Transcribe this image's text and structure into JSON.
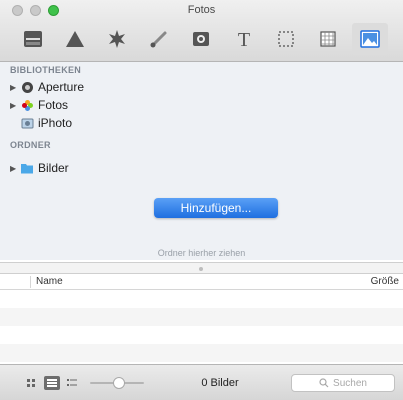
{
  "window": {
    "title": "Fotos"
  },
  "toolbar": {
    "tools": [
      {
        "icon": "media-browser-icon"
      },
      {
        "icon": "shapes-icon"
      },
      {
        "icon": "effects-icon"
      },
      {
        "icon": "brush-icon"
      },
      {
        "icon": "video-icon"
      },
      {
        "icon": "text-icon"
      },
      {
        "icon": "selection-icon"
      },
      {
        "icon": "texture-icon"
      },
      {
        "icon": "photos-icon",
        "active": true
      }
    ]
  },
  "sidebar": {
    "libraries_header": "BIBLIOTHEKEN",
    "libraries": [
      {
        "label": "Aperture",
        "icon": "aperture-icon",
        "expandable": true
      },
      {
        "label": "Fotos",
        "icon": "fotos-icon",
        "expandable": true
      },
      {
        "label": "iPhoto",
        "icon": "iphoto-icon",
        "expandable": false
      }
    ],
    "folders_header": "ORDNER",
    "folders": [
      {
        "label": "Bilder",
        "icon": "folder-icon",
        "expandable": true
      }
    ],
    "add_button": "Hinzufügen...",
    "drop_hint": "Ordner hierher ziehen"
  },
  "table": {
    "columns": [
      "Name",
      "Größe"
    ],
    "rows": []
  },
  "bottombar": {
    "count": "0 Bilder",
    "search_placeholder": "Suchen"
  },
  "colors": {
    "accent": "#1f6fe0",
    "sidebar_bg": "#eef1f5"
  }
}
